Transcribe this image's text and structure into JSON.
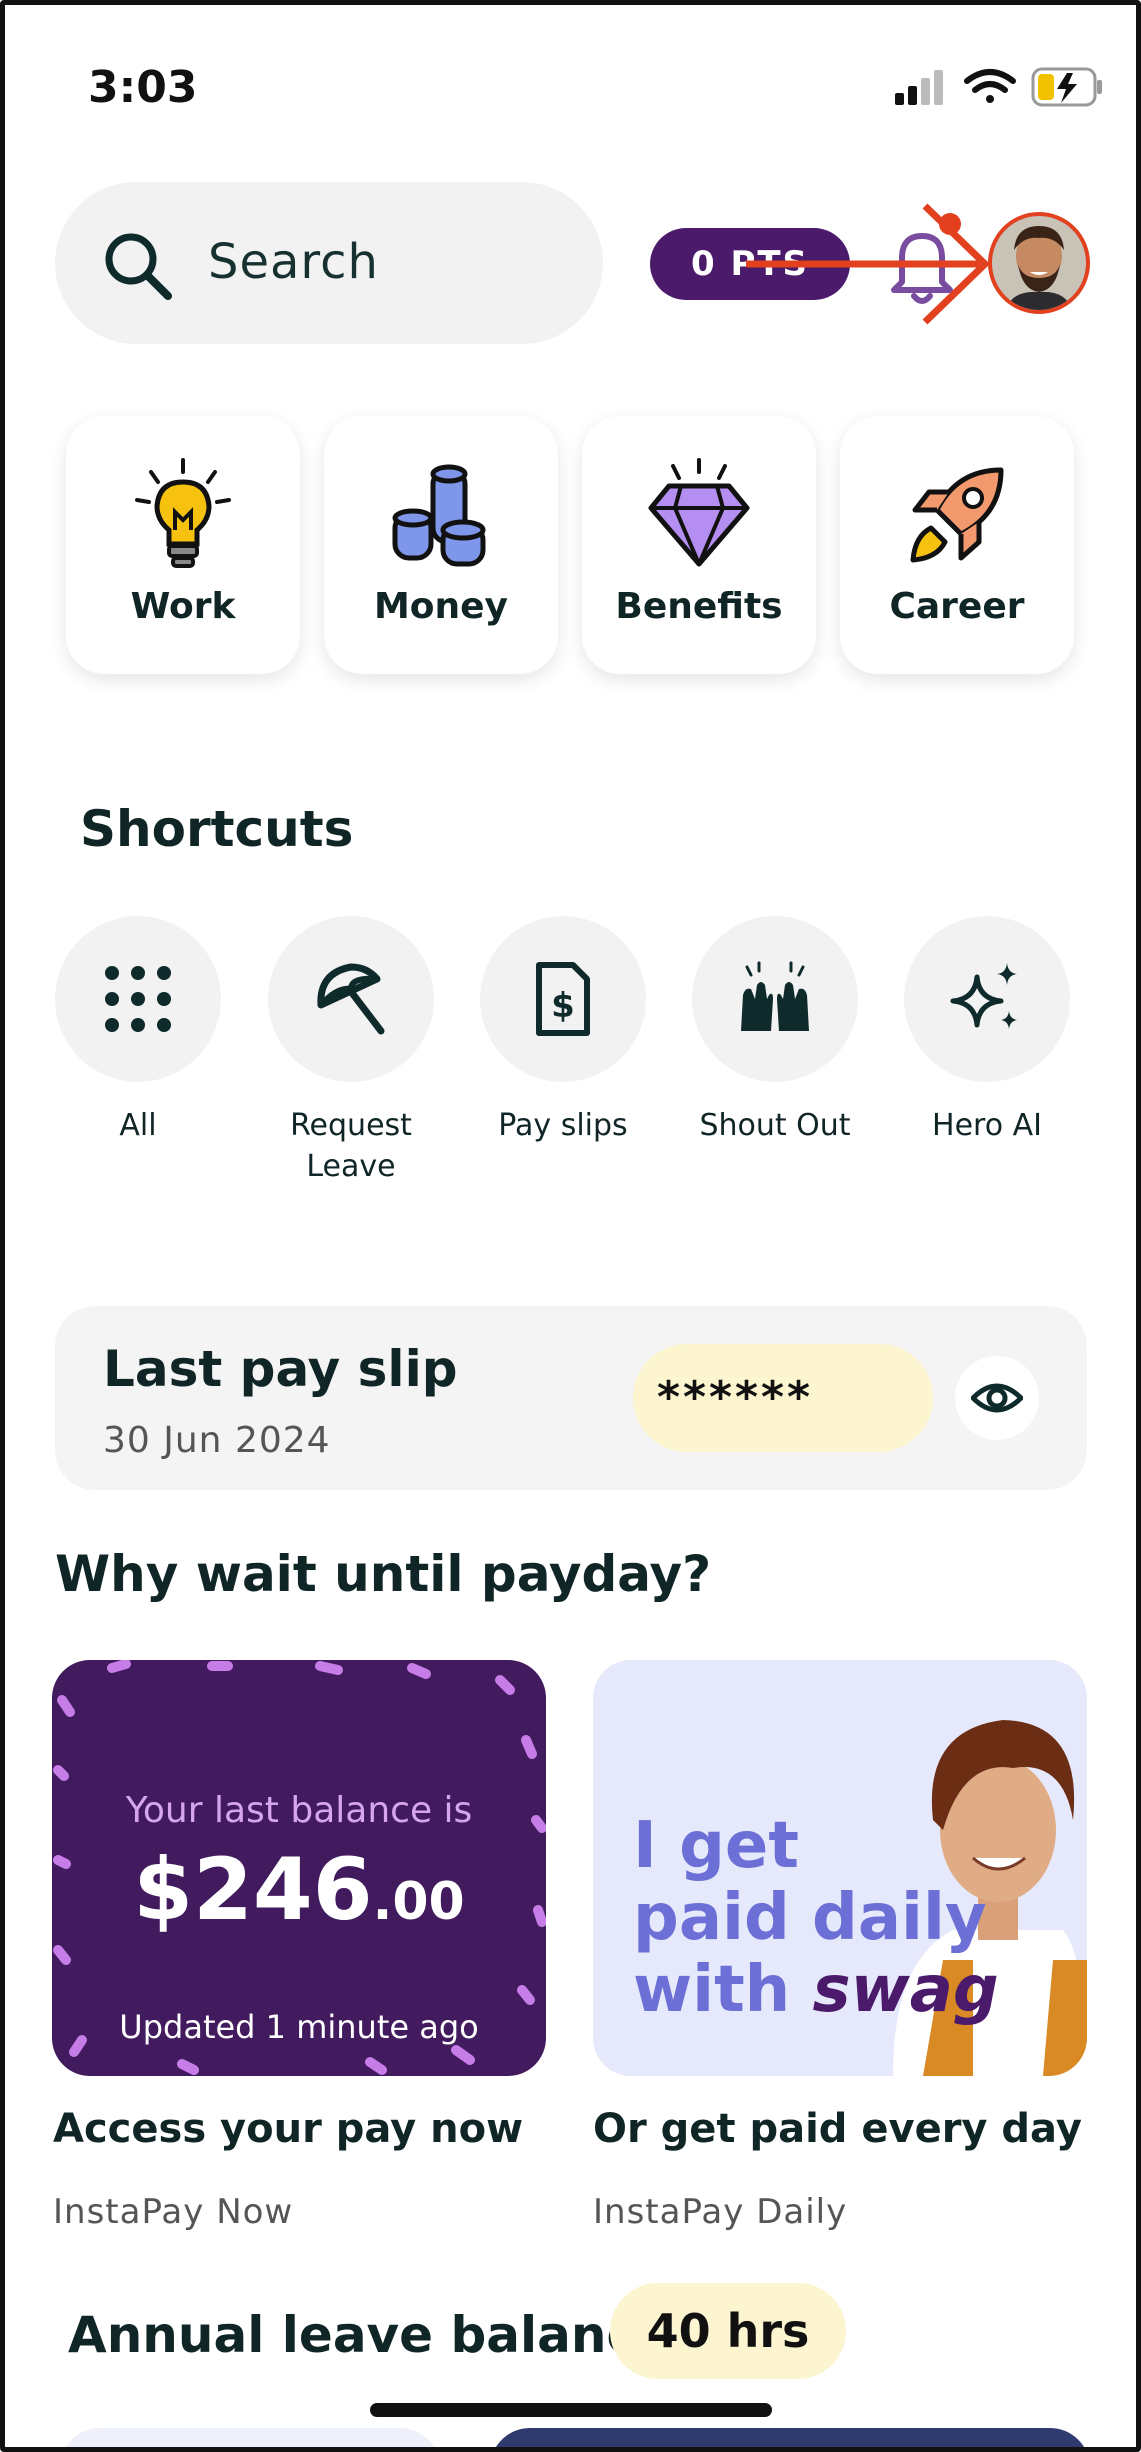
{
  "status_bar": {
    "time": "3:03"
  },
  "search": {
    "label": "Search"
  },
  "header": {
    "points": "0 PTS"
  },
  "categories": [
    {
      "label": "Work",
      "icon": "lightbulb-icon"
    },
    {
      "label": "Money",
      "icon": "coins-icon"
    },
    {
      "label": "Benefits",
      "icon": "diamond-icon"
    },
    {
      "label": "Career",
      "icon": "rocket-icon"
    }
  ],
  "shortcuts": {
    "title": "Shortcuts",
    "items": [
      {
        "label": "All",
        "icon": "grid-dots-icon"
      },
      {
        "label": "Request Leave",
        "icon": "umbrella-icon"
      },
      {
        "label": "Pay slips",
        "icon": "document-dollar-icon"
      },
      {
        "label": "Shout Out",
        "icon": "raised-hands-icon"
      },
      {
        "label": "Hero AI",
        "icon": "sparkle-icon"
      }
    ]
  },
  "payslip": {
    "title": "Last pay slip",
    "date": "30 Jun 2024",
    "masked_amount": "******"
  },
  "instapay": {
    "section_title": "Why wait until payday?",
    "card1": {
      "balance_label": "Your last balance is",
      "amount_main": "$246",
      "amount_cents": ".00",
      "updated": "Updated 1 minute ago",
      "title": "Access your pay now",
      "subtitle": "InstaPay Now"
    },
    "card2": {
      "promo_line1": "I get",
      "promo_line2": "paid daily",
      "promo_line3": "with",
      "promo_brand": "swag",
      "title": "Or get paid every day",
      "subtitle": "InstaPay Daily"
    }
  },
  "annual_leave": {
    "title": "Annual leave balance",
    "value": "40 hrs"
  },
  "colors": {
    "brand_purple": "#4b1a6b",
    "accent_red": "#e2401f",
    "highlight_yellow": "#fcf5cf"
  }
}
